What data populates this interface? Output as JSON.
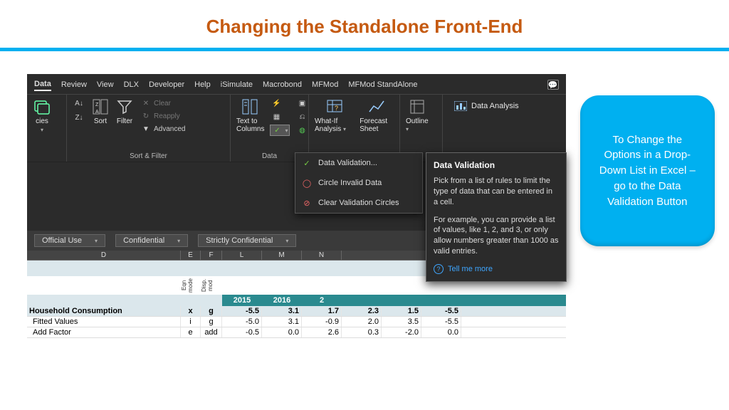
{
  "slide": {
    "title": "Changing the Standalone Front-End"
  },
  "callout": {
    "text": "To Change the Options in a Drop-Down List in Excel – go to the Data Validation Button"
  },
  "tabs": [
    "Data",
    "Review",
    "View",
    "DLX",
    "Developer",
    "Help",
    "iSimulate",
    "Macrobond",
    "MFMod",
    "MFMod StandAlone"
  ],
  "ribbon": {
    "sort": {
      "az": "A→Z",
      "za": "Z→A",
      "label": "Sort"
    },
    "filter": {
      "label": "Filter",
      "clear": "Clear",
      "reapply": "Reapply",
      "advanced": "Advanced"
    },
    "group_sortfilter": "Sort & Filter",
    "ttc": "Text to Columns",
    "group_data": "Data",
    "whatif": "What-If Analysis",
    "forecast": "Forecast Sheet",
    "outline": "Outline",
    "analysis": "Data Analysis",
    "cies": "cies"
  },
  "dropdown": {
    "dv": "Data Validation...",
    "circle": "Circle Invalid Data",
    "clear": "Clear Validation Circles"
  },
  "tooltip": {
    "title": "Data Validation",
    "p1": "Pick from a list of rules to limit the type of data that can be entered in a cell.",
    "p2": "For example, you can provide a list of values, like 1, 2, and 3, or only allow numbers greater than 1000 as valid entries.",
    "tell": "Tell me more"
  },
  "classification": {
    "a": "Official Use",
    "b": "Confidential",
    "c": "Strictly Confidential"
  },
  "cols": {
    "d": "D",
    "e": "E",
    "f": "F",
    "l": "L",
    "m": "M",
    "n": "N"
  },
  "rot": {
    "eqn": "Eqn mode",
    "disp": "Disp. mod"
  },
  "years": {
    "y15": "2015",
    "y16": "2016",
    "y17": "2"
  },
  "rows": {
    "hc": {
      "label": "Household Consumption",
      "e": "x",
      "f": "g",
      "v": [
        "-5.5",
        "3.1",
        "1.7",
        "2.3",
        "1.5",
        "-5.5"
      ]
    },
    "fv": {
      "label": "Fitted Values",
      "e": "i",
      "f": "g",
      "v": [
        "-5.0",
        "3.1",
        "-0.9",
        "2.0",
        "3.5",
        "-5.5"
      ]
    },
    "af": {
      "label": "Add Factor",
      "e": "e",
      "f": "add",
      "v": [
        "-0.5",
        "0.0",
        "2.6",
        "0.3",
        "-2.0",
        "0.0"
      ]
    }
  }
}
